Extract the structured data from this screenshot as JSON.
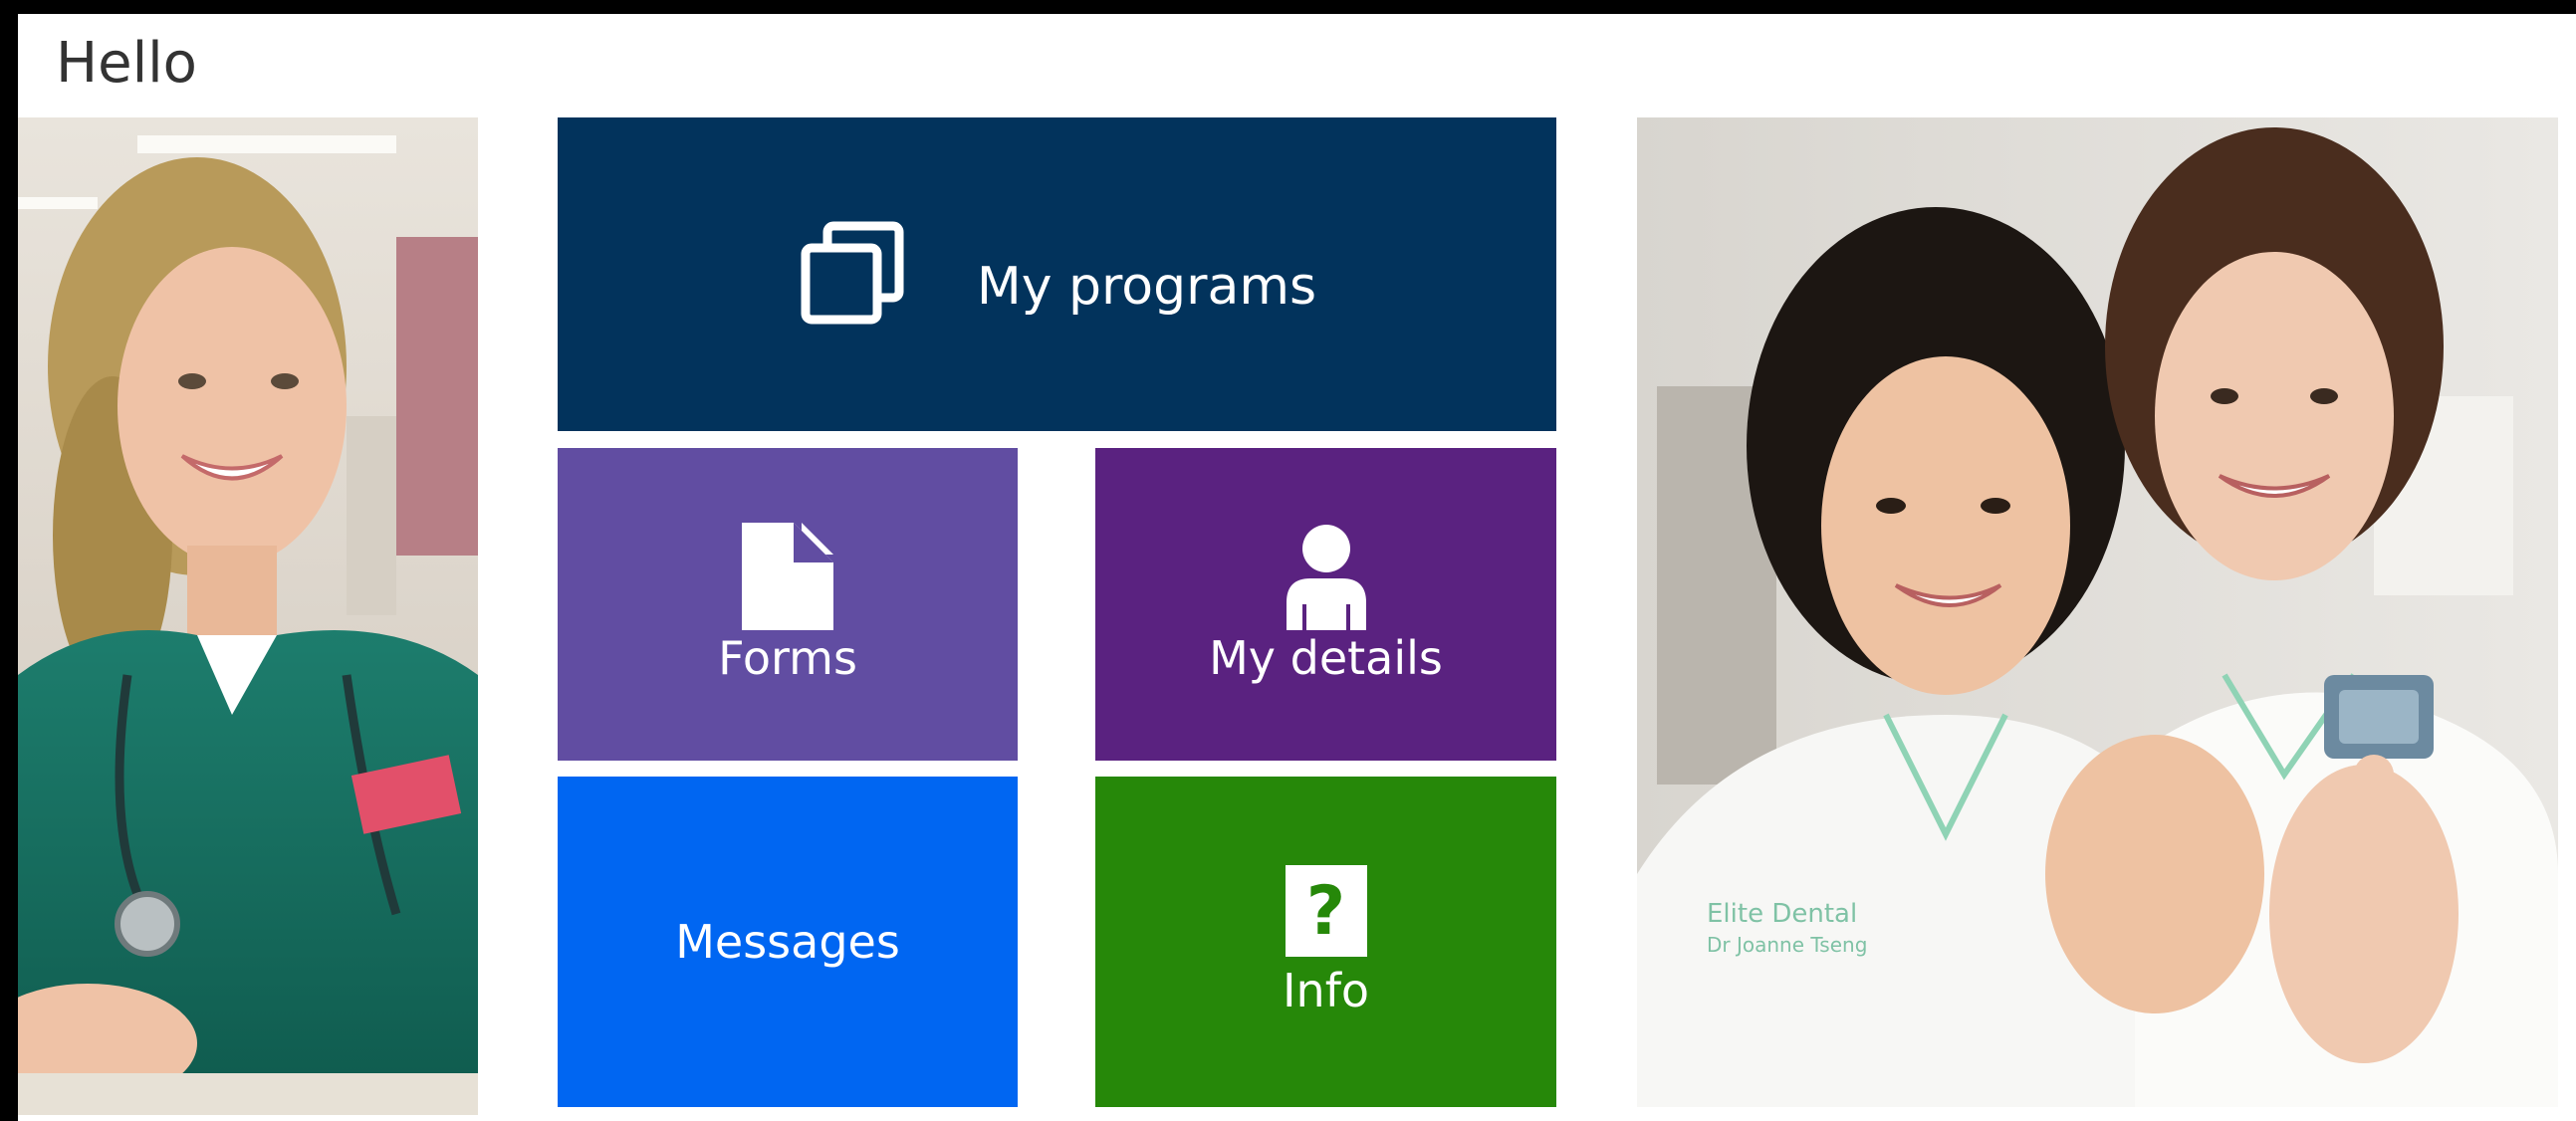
{
  "greeting": "Hello",
  "tiles": {
    "programs": {
      "label": "My programs",
      "icon": "windows-stack-icon",
      "color": "#02335c"
    },
    "forms": {
      "label": "Forms",
      "icon": "document-icon",
      "color": "#614da2"
    },
    "details": {
      "label": "My details",
      "icon": "person-icon",
      "color": "#5a2280"
    },
    "messages": {
      "label": "Messages",
      "color": "#0066f2"
    },
    "info": {
      "label": "Info",
      "icon": "question-icon",
      "icon_glyph": "?",
      "color": "#268809"
    }
  },
  "photos": {
    "left": {
      "badge_text": ""
    },
    "right": {
      "coat_text_line1": "Elite Dental",
      "coat_text_line2": "Dr Joanne Tseng"
    }
  }
}
